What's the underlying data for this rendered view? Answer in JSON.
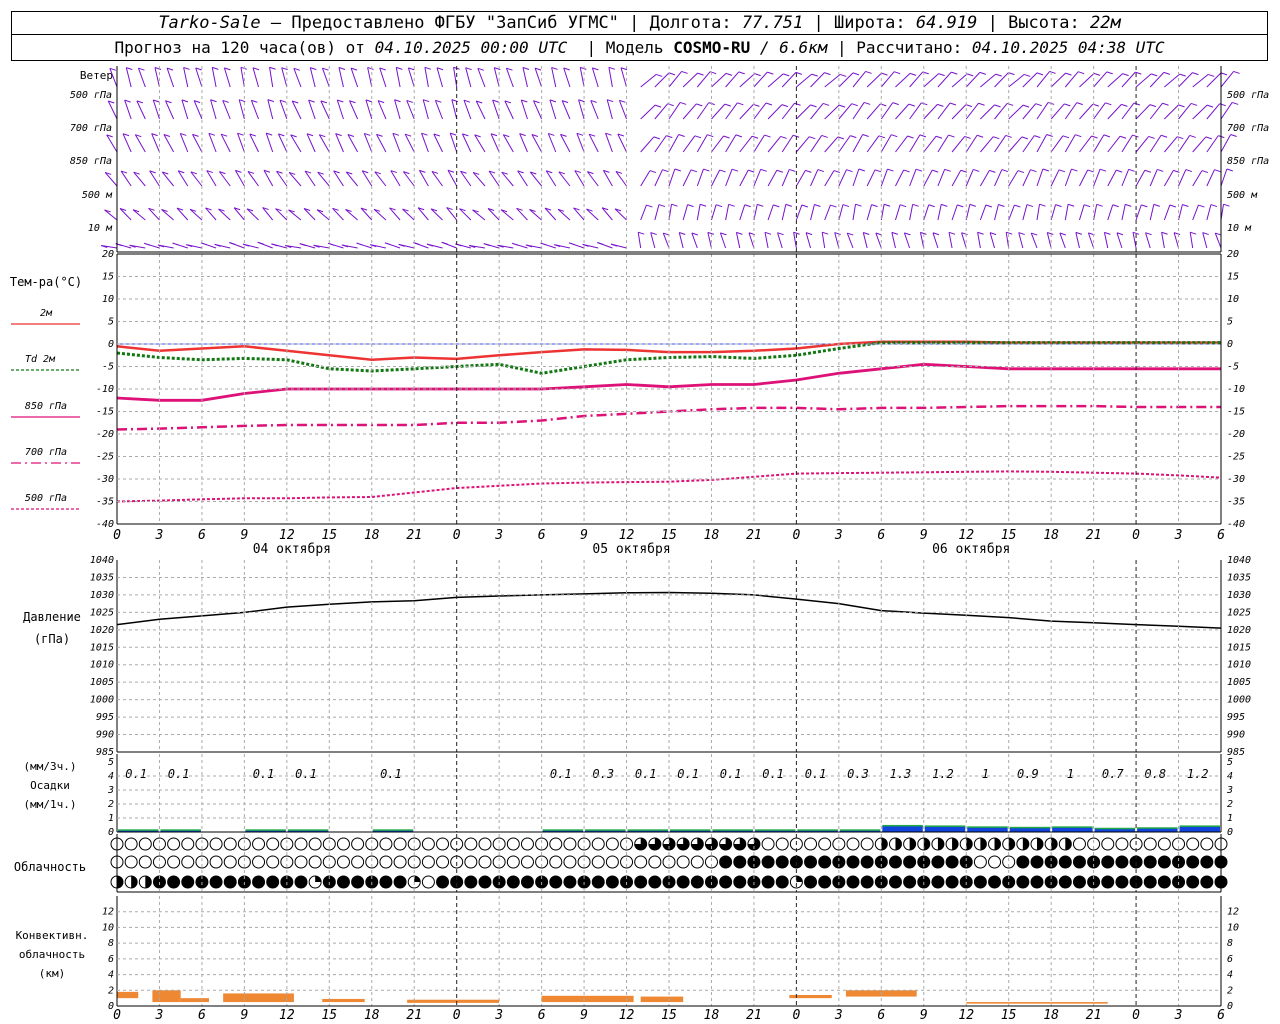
{
  "header": {
    "station": "Tarko-Sale",
    "provider": "– Предоставлено ФГБУ \"ЗапСиб УГМС\"",
    "sep": "|",
    "lon_label": "Долгота:",
    "lon": "77.751",
    "lat_label": "Широта:",
    "lat": "64.919",
    "alt_label": "Высота:",
    "alt": "22м",
    "forecast_label": "Прогноз на 120 часа(ов) от",
    "forecast_start": "04.10.2025 00:00 UTC",
    "model_label": "Модель",
    "model_name": "COSMO-RU",
    "model_res": "/ 6.6км",
    "calc_label": "Рассчитано:",
    "calc_time": "04.10.2025 04:38 UTC"
  },
  "hour_ticks": [
    "0",
    "3",
    "6",
    "9",
    "12",
    "15",
    "18",
    "21",
    "0",
    "3",
    "6",
    "9",
    "12",
    "15",
    "18",
    "21",
    "0",
    "3",
    "6",
    "9",
    "12",
    "15",
    "18",
    "21",
    "0",
    "3",
    "6"
  ],
  "day_labels": [
    "04 октября",
    "05 октября",
    "06 октября"
  ],
  "wind": {
    "title": "Ветер",
    "levels": [
      "500 гПа",
      "700 гПа",
      "850 гПа",
      "500 м",
      "10  м"
    ]
  },
  "temperature": {
    "title": "Тем-ра(°C)",
    "legend": [
      {
        "label": "2м",
        "color": "#ee3333",
        "dash": ""
      },
      {
        "label": "Td  2м",
        "color": "#117711",
        "dash": "3,2"
      },
      {
        "label": "850 гПа",
        "color": "#dd1177",
        "dash": ""
      },
      {
        "label": "700 гПа",
        "color": "#dd1177",
        "dash": "10,4,2,4"
      },
      {
        "label": "500 гПа",
        "color": "#dd1177",
        "dash": "3,2"
      }
    ],
    "ylim": [
      -40,
      20
    ],
    "yticks": [
      "20",
      "15",
      "10",
      "5",
      "0",
      "-5",
      "-10",
      "-15",
      "-20",
      "-25",
      "-30",
      "-35",
      "-40"
    ]
  },
  "pressure": {
    "title": "Давление",
    "unit": "(гПа)",
    "ylim": [
      985,
      1040
    ],
    "yticks": [
      "1040",
      "1035",
      "1030",
      "1025",
      "1020",
      "1015",
      "1010",
      "1005",
      "1000",
      "995",
      "990",
      "985"
    ]
  },
  "precip": {
    "unit_top": "(мм/3ч.)",
    "title": "Осадки",
    "unit_bottom": "(мм/1ч.)",
    "yticks": [
      "5",
      "4",
      "3",
      "2",
      "1",
      "0"
    ],
    "labels": [
      "0.1",
      "0.1",
      "0.1",
      "0.1",
      "0.1",
      "0.1",
      "0.3",
      "0.1",
      "0.1",
      "0.1",
      "0.1",
      "0.1",
      "0.3",
      "1.3",
      "1.2",
      "1",
      "0.9",
      "1",
      "0.7",
      "0.8",
      "1.2"
    ]
  },
  "clouds": {
    "title": "Облачность"
  },
  "convective": {
    "title_1": "Конвективн.",
    "title_2": "облачность",
    "unit": "(км)",
    "yticks": [
      "12",
      "10",
      "8",
      "6",
      "4",
      "2",
      "0"
    ]
  },
  "colors": {
    "wind": "#7711cc",
    "pressure_line": "#000000",
    "precip_bar": "#1144dd",
    "precip_cap": "#22aa44",
    "convective_bar": "#ee8833",
    "grid": "#aaaaaa"
  },
  "chart_data": [
    {
      "type": "line",
      "title": "Тем-ра(°C)",
      "x_hours": [
        0,
        3,
        6,
        9,
        12,
        15,
        18,
        21,
        24,
        27,
        30,
        33,
        36,
        39,
        42,
        45,
        48,
        51,
        54,
        57,
        60,
        63,
        66,
        69,
        72,
        75,
        78
      ],
      "ylim": [
        -40,
        20
      ],
      "series": [
        {
          "name": "2м",
          "values": [
            -0.5,
            -1.5,
            -1,
            -0.5,
            -1.5,
            -2.5,
            -3.5,
            -3,
            -3.3,
            -2.5,
            -1.8,
            -1.2,
            -1.3,
            -1.8,
            -1.8,
            -1.5,
            -1,
            0,
            0.5,
            0.5,
            0.5,
            0.3,
            0.3,
            0.3,
            0.3,
            0.3,
            0.3
          ]
        },
        {
          "name": "Td  2м",
          "values": [
            -2,
            -3,
            -3.5,
            -3.2,
            -3.5,
            -5.5,
            -6,
            -5.5,
            -5,
            -4.5,
            -6.5,
            -5,
            -3.5,
            -3,
            -2.8,
            -3.2,
            -2.5,
            -1,
            0.3,
            0.3,
            0.3,
            0.3,
            0.3,
            0.3,
            0.3,
            0.3,
            0.3
          ]
        },
        {
          "name": "850 гПа",
          "values": [
            -12,
            -12.5,
            -12.5,
            -11,
            -10,
            -10,
            -10,
            -10,
            -10,
            -10,
            -10,
            -9.5,
            -9,
            -9.5,
            -9,
            -9,
            -8,
            -6.5,
            -5.5,
            -4.5,
            -5,
            -5.5,
            -5.5,
            -5.5,
            -5.5,
            -5.5,
            -5.5
          ]
        },
        {
          "name": "700 гПа",
          "values": [
            -19,
            -18.8,
            -18.5,
            -18.2,
            -18,
            -18,
            -18,
            -18,
            -17.5,
            -17.5,
            -17,
            -16,
            -15.5,
            -15,
            -14.5,
            -14.2,
            -14.2,
            -14.5,
            -14.2,
            -14.2,
            -14,
            -13.8,
            -13.8,
            -13.8,
            -14,
            -14,
            -14
          ]
        },
        {
          "name": "500 гПа",
          "values": [
            -35,
            -34.8,
            -34.5,
            -34.3,
            -34.3,
            -34.1,
            -34,
            -33,
            -32,
            -31.5,
            -31,
            -30.8,
            -30.7,
            -30.6,
            -30.2,
            -29.5,
            -28.8,
            -28.7,
            -28.6,
            -28.5,
            -28.4,
            -28.3,
            -28.4,
            -28.6,
            -28.8,
            -29.2,
            -29.7
          ]
        }
      ]
    },
    {
      "type": "line",
      "title": "Давление",
      "x_hours": [
        0,
        3,
        6,
        9,
        12,
        15,
        18,
        21,
        24,
        27,
        30,
        33,
        36,
        39,
        42,
        45,
        48,
        51,
        54,
        57,
        60,
        63,
        66,
        69,
        72,
        75,
        78
      ],
      "ylim": [
        985,
        1040
      ],
      "series": [
        {
          "name": "",
          "values": [
            1021.5,
            1023,
            1024,
            1025,
            1026.5,
            1027.3,
            1028,
            1028.3,
            1029.3,
            1029.7,
            1030,
            1030.3,
            1030.6,
            1030.7,
            1030.5,
            1030,
            1028.8,
            1027.5,
            1025.5,
            1024.8,
            1024.2,
            1023.5,
            1022.5,
            1022,
            1021.5,
            1021,
            1020.5
          ]
        }
      ]
    },
    {
      "type": "bar",
      "title": "Осадки",
      "x_hours": [
        3,
        6,
        12,
        15,
        21,
        24,
        33,
        36,
        39,
        42,
        45,
        48,
        51,
        54,
        57,
        60,
        63,
        66,
        69,
        72,
        75,
        78
      ],
      "values": [
        0.1,
        0.1,
        0.1,
        0.1,
        0.1,
        0,
        0.1,
        0.3,
        0.1,
        0.1,
        0.1,
        0.1,
        0.1,
        0.3,
        1.3,
        1.2,
        1,
        0.9,
        1,
        0.7,
        0.8,
        1.2
      ],
      "ylim": [
        0,
        5
      ]
    },
    {
      "type": "bar",
      "title": "Конвективн. облачность",
      "segments": [
        {
          "from": 0,
          "to": 1.5,
          "base": 1,
          "top": 1.8
        },
        {
          "from": 2.5,
          "to": 4.5,
          "base": 0.5,
          "top": 2
        },
        {
          "from": 4.5,
          "to": 6.5,
          "base": 0.5,
          "top": 1
        },
        {
          "from": 7.5,
          "to": 12.5,
          "base": 0.5,
          "top": 1.6
        },
        {
          "from": 14.5,
          "to": 17.5,
          "base": 0.5,
          "top": 0.9
        },
        {
          "from": 20.5,
          "to": 27,
          "base": 0.4,
          "top": 0.8
        },
        {
          "from": 30,
          "to": 36.5,
          "base": 0.5,
          "top": 1.3
        },
        {
          "from": 37,
          "to": 40,
          "base": 0.5,
          "top": 1.2
        },
        {
          "from": 47.5,
          "to": 50.5,
          "base": 1,
          "top": 1.4
        },
        {
          "from": 51.5,
          "to": 56.5,
          "base": 1.2,
          "top": 2
        },
        {
          "from": 60,
          "to": 70,
          "base": 0.3,
          "top": 0.5
        }
      ],
      "ylim": [
        0,
        14
      ]
    }
  ]
}
